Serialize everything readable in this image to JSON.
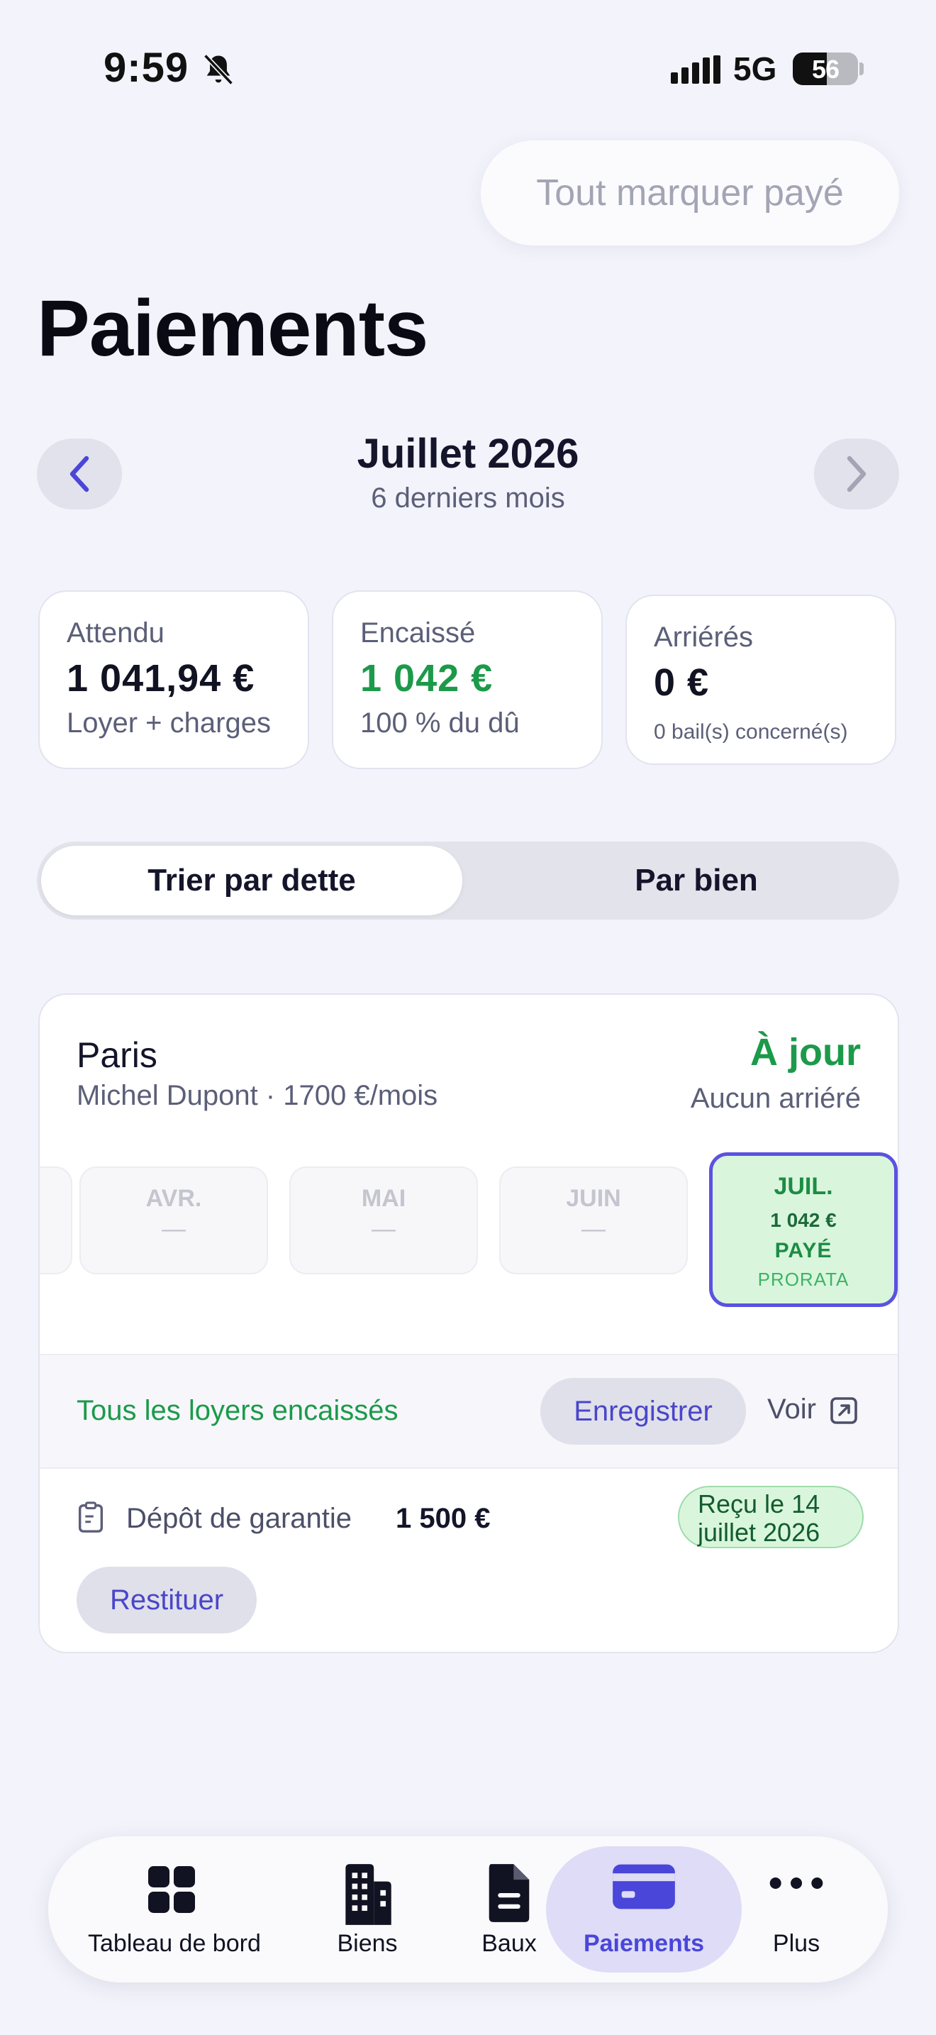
{
  "status_bar": {
    "time": "9:59",
    "network": "5G",
    "battery": "56"
  },
  "header": {
    "mark_all_paid": "Tout marquer payé",
    "title": "Paiements"
  },
  "period": {
    "month": "Juillet 2026",
    "range": "6 derniers mois"
  },
  "summary": [
    {
      "label": "Attendu",
      "value": "1 041,94 €",
      "note": "Loyer + charges",
      "color": "#111322"
    },
    {
      "label": "Encaissé",
      "value": "1 042 €",
      "note": "100 % du dû",
      "color": "#1c9a4a"
    },
    {
      "label": "Arriérés",
      "value": "0 €",
      "note": "0 bail(s) concerné(s)",
      "color": "#111322"
    }
  ],
  "sort": {
    "by_debt": "Trier par dette",
    "by_property": "Par bien",
    "selected": "by_debt"
  },
  "property": {
    "city": "Paris",
    "tenant": "Michel Dupont · 1700 €/mois",
    "status": "À jour",
    "status_sub": "Aucun arriéré",
    "months": [
      {
        "name": "AVR.",
        "value": "—"
      },
      {
        "name": "MAI",
        "value": "—"
      },
      {
        "name": "JUIN",
        "value": "—"
      }
    ],
    "current_month": {
      "name": "JUIL.",
      "amount": "1 042 €",
      "status": "PAYÉ",
      "note": "PRORATA"
    },
    "all_paid": "Tous les loyers encaissés",
    "record": "Enregistrer",
    "view": "Voir",
    "deposit_label": "Dépôt de garantie",
    "deposit_amount": "1 500 €",
    "deposit_badge_line1": "Reçu le 14",
    "deposit_badge_line2": "juillet 2026",
    "restore": "Restituer"
  },
  "tabbar": [
    {
      "label": "Tableau de bord",
      "icon": "dashboard-icon"
    },
    {
      "label": "Biens",
      "icon": "building-icon"
    },
    {
      "label": "Baux",
      "icon": "document-icon"
    },
    {
      "label": "Paiements",
      "icon": "card-icon",
      "active": true
    },
    {
      "label": "Plus",
      "icon": "more-icon"
    }
  ],
  "colors": {
    "accent": "#4a46d9",
    "success": "#1c9a4a",
    "background": "#f3f3fb"
  }
}
